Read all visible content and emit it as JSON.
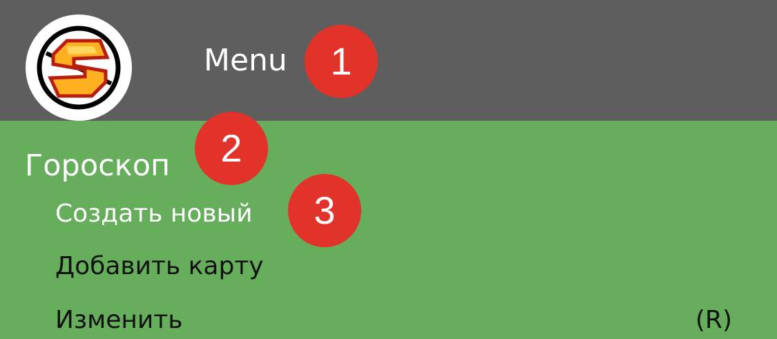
{
  "header": {
    "logo_icon": "s-logo-icon",
    "title": "Menu"
  },
  "menu": {
    "section_title": "Гороскоп",
    "items": [
      {
        "label": "Создать новый",
        "state": "active"
      },
      {
        "label": "Добавить карту"
      },
      {
        "label": "Изменить",
        "shortcut": "(R)"
      }
    ]
  },
  "annotations": [
    {
      "number": "1"
    },
    {
      "number": "2"
    },
    {
      "number": "3"
    }
  ],
  "colors": {
    "header_bg": "#5e5e5e",
    "menu_bg": "#66ad5c",
    "badge": "#e2332a",
    "active_text": "#ffffff"
  }
}
